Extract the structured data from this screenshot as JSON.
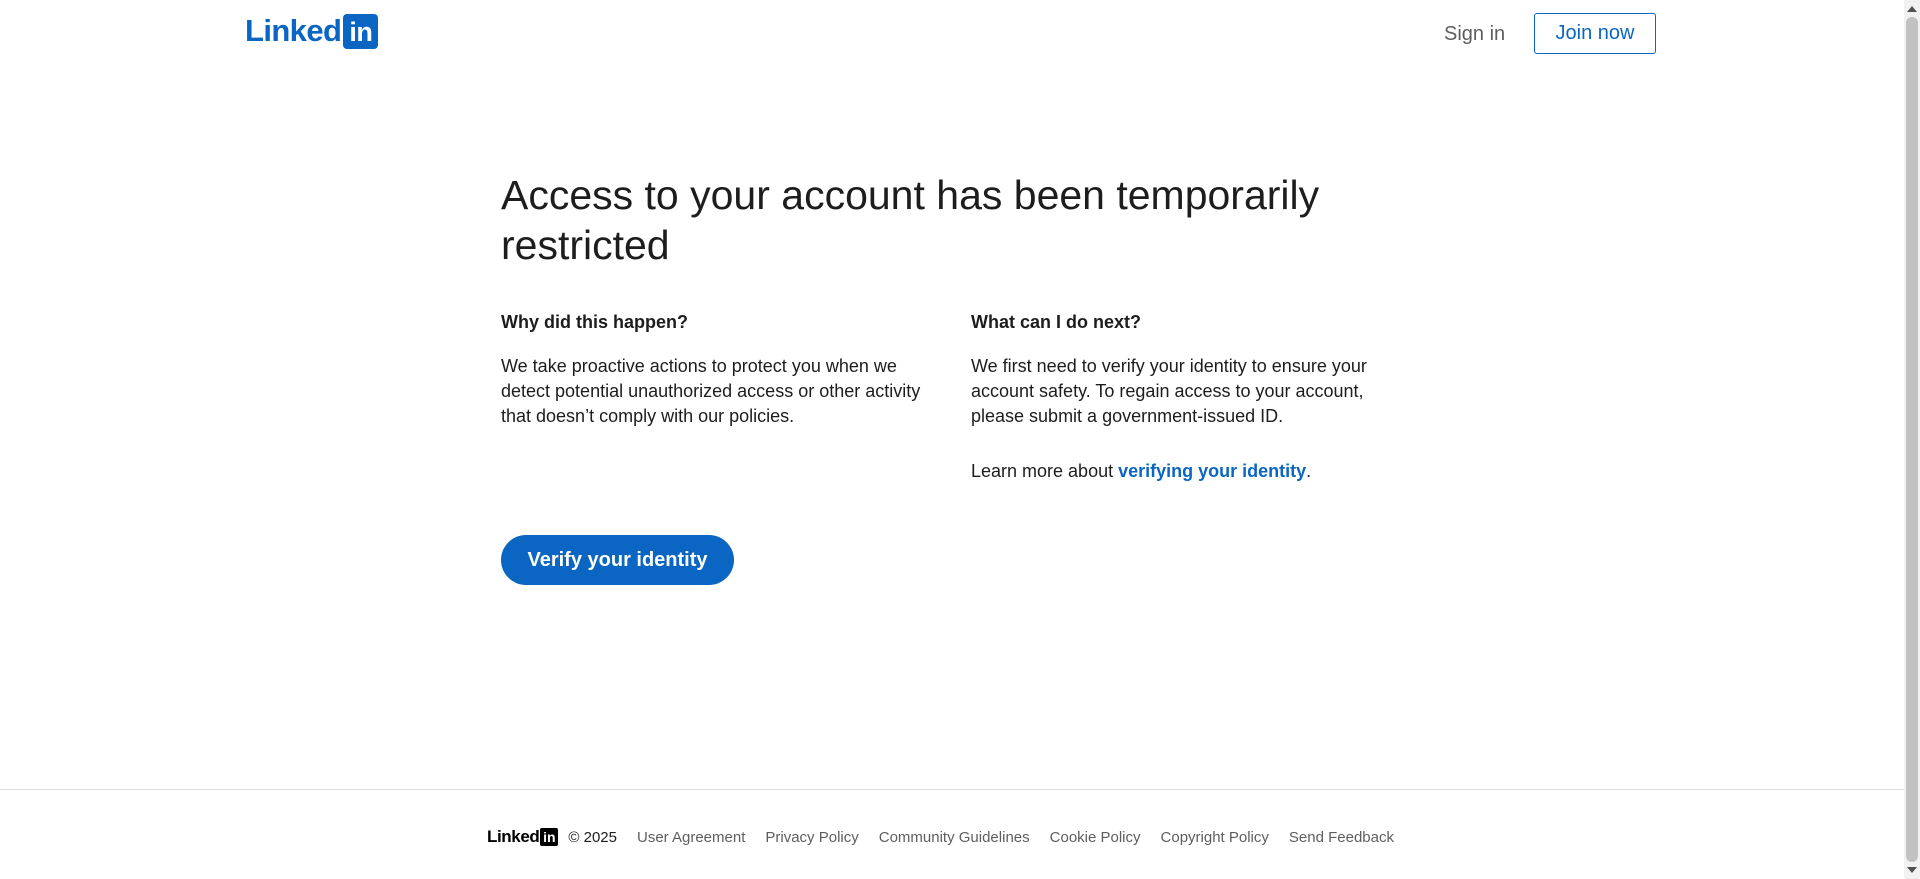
{
  "header": {
    "logo_text": "Linked",
    "logo_badge": "in",
    "sign_in": "Sign in",
    "join_now": "Join now"
  },
  "main": {
    "title": "Access to your account has been temporarily restricted",
    "why": {
      "heading": "Why did this happen?",
      "body": "We take proactive actions to protect you when we detect potential unauthorized access or other activity that doesn’t comply with our policies."
    },
    "next": {
      "heading": "What can I do next?",
      "body": "We first need to verify your identity to ensure your account safety. To regain access to your account, please submit a government-issued ID.",
      "learn_prefix": "Learn more about ",
      "learn_link": "verifying your identity",
      "learn_suffix": "."
    },
    "verify_button": "Verify your identity"
  },
  "footer": {
    "logo_text": "Linked",
    "logo_badge": "in",
    "copyright": "© 2025",
    "links": [
      "User Agreement",
      "Privacy Policy",
      "Community Guidelines",
      "Cookie Policy",
      "Copyright Policy",
      "Send Feedback"
    ]
  },
  "colors": {
    "brand": "#0a66c2",
    "text": "#1d1d1d",
    "muted": "#5e5e5e"
  },
  "icons": {
    "scroll_up": "scroll-up-arrow-icon",
    "scroll_down": "scroll-down-arrow-icon"
  }
}
